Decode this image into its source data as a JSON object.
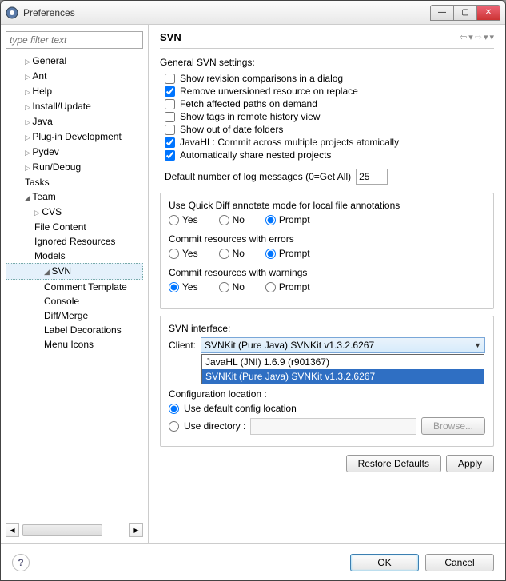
{
  "window": {
    "title": "Preferences"
  },
  "sidebar": {
    "filter_placeholder": "type filter text",
    "items": {
      "general": "General",
      "ant": "Ant",
      "help": "Help",
      "install": "Install/Update",
      "java": "Java",
      "plugin": "Plug-in Development",
      "pydev": "Pydev",
      "rundebug": "Run/Debug",
      "tasks": "Tasks",
      "team": "Team",
      "cvs": "CVS",
      "filecontent": "File Content",
      "ignored": "Ignored Resources",
      "models": "Models",
      "svn": "SVN",
      "comment": "Comment Template",
      "console": "Console",
      "diffmerge": "Diff/Merge",
      "labeldec": "Label Decorations",
      "menuicons": "Menu Icons"
    }
  },
  "page": {
    "heading": "SVN",
    "general_label": "General SVN settings:",
    "chk": {
      "revision": "Show revision comparisons in a dialog",
      "remove": "Remove unversioned resource on replace",
      "fetch": "Fetch affected paths on demand",
      "tags": "Show tags in remote history view",
      "outofdate": "Show out of date folders",
      "javahl": "JavaHL: Commit across multiple projects atomically",
      "autoshare": "Automatically share nested projects"
    },
    "logmsg_label": "Default number of log messages (0=Get All)",
    "logmsg_value": "25",
    "quickdiff_label": "Use Quick Diff annotate mode for local file annotations",
    "commit_err_label": "Commit resources with errors",
    "commit_warn_label": "Commit resources with warnings",
    "radio": {
      "yes": "Yes",
      "no": "No",
      "prompt": "Prompt"
    },
    "svn_interface_label": "SVN interface:",
    "client_label": "Client:",
    "client_value": "SVNKit (Pure Java) SVNKit v1.3.2.6267",
    "client_options": {
      "opt1": "JavaHL (JNI) 1.6.9 (r901367)",
      "opt2": "SVNKit (Pure Java) SVNKit v1.3.2.6267"
    },
    "config_loc_label": "Configuration location :",
    "use_default": "Use default config location",
    "use_dir": "Use directory :",
    "browse": "Browse...",
    "restore": "Restore Defaults",
    "apply": "Apply"
  },
  "footer": {
    "ok": "OK",
    "cancel": "Cancel"
  }
}
